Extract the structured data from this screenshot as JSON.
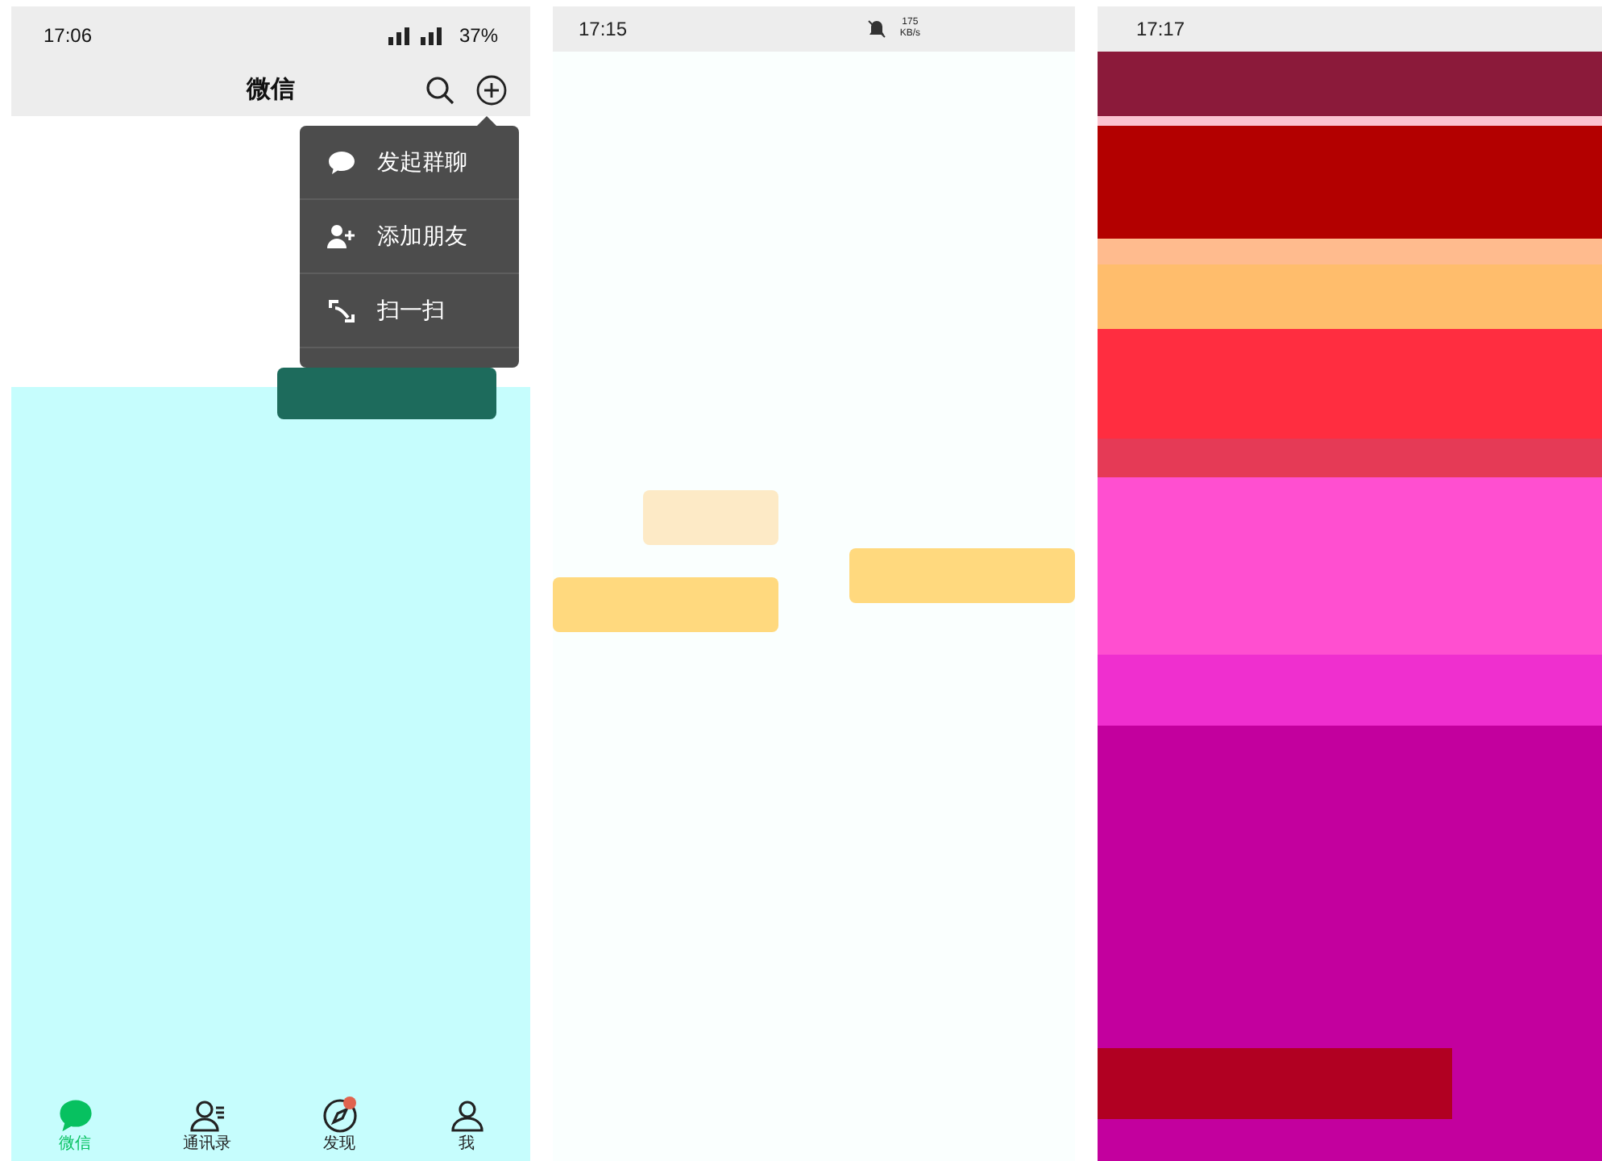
{
  "panels": [
    {
      "kind": "chats",
      "status_bar": {
        "time": "17:06",
        "battery": "37%"
      },
      "title": "微信",
      "menu": [
        {
          "label": "发起群聊"
        },
        {
          "label": "添加朋友"
        },
        {
          "label": "扫一扫"
        }
      ],
      "tabs": [
        {
          "label": "微信",
          "selected": true,
          "badge": false
        },
        {
          "label": "通讯录",
          "selected": false,
          "badge": false
        },
        {
          "label": "发现",
          "selected": false,
          "badge": true
        },
        {
          "label": "我",
          "selected": false,
          "badge": false
        }
      ]
    },
    {
      "kind": "blank",
      "status_bar": {
        "time": "17:15",
        "net_speed": [
          "175",
          "KB/s"
        ]
      }
    },
    {
      "kind": "distorted",
      "status_bar": {
        "time": "17:17"
      }
    }
  ]
}
